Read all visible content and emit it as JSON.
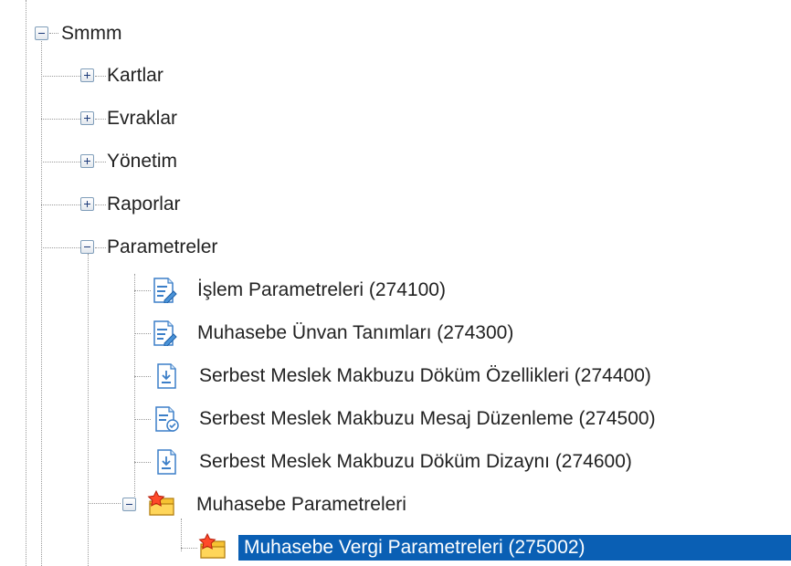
{
  "tree": {
    "root": {
      "label": "Smmm",
      "expanded": true
    },
    "children": [
      {
        "label": "Kartlar",
        "expanded": false
      },
      {
        "label": "Evraklar",
        "expanded": false
      },
      {
        "label": "Yönetim",
        "expanded": false
      },
      {
        "label": "Raporlar",
        "expanded": false
      },
      {
        "label": "Parametreler",
        "expanded": true,
        "items": [
          {
            "label": "İşlem Parametreleri (274100)",
            "icon": "form-edit-icon"
          },
          {
            "label": "Muhasebe Ünvan Tanımları (274300)",
            "icon": "form-edit-icon"
          },
          {
            "label": "Serbest Meslek Makbuzu Döküm Özellikleri (274400)",
            "icon": "document-download-icon"
          },
          {
            "label": "Serbest Meslek Makbuzu Mesaj Düzenleme (274500)",
            "icon": "document-check-icon"
          },
          {
            "label": "Serbest Meslek Makbuzu Döküm Dizaynı (274600)",
            "icon": "document-download-icon"
          }
        ]
      }
    ],
    "favorites": {
      "label": "Muhasebe Parametreleri",
      "icon": "favorites-star-folder-icon",
      "expanded": true,
      "items": [
        {
          "label": "Muhasebe Vergi Parametreleri (275002)",
          "icon": "favorites-star-folder-icon",
          "selected": true
        }
      ]
    }
  },
  "colors": {
    "selection": "#0a5fb4",
    "selection_text": "#ffffff",
    "guide_line": "#9a9a9a",
    "toggle_border": "#7f9db9"
  }
}
